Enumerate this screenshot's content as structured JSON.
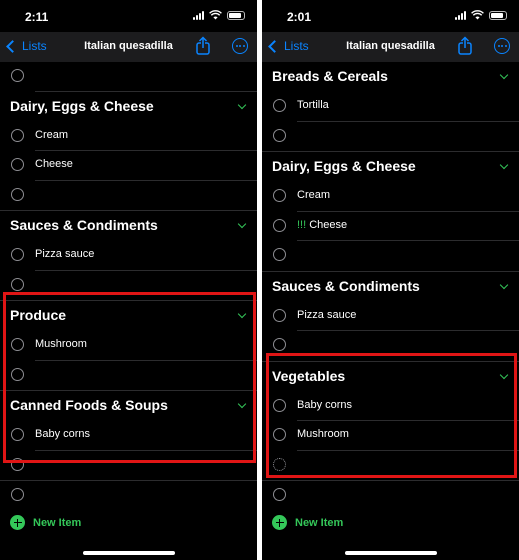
{
  "left": {
    "time": "2:11",
    "back_label": "Lists",
    "title": "Italian quesadilla",
    "sections": [
      {
        "title": "Dairy, Eggs & Cheese",
        "items": [
          "Cream",
          "Cheese"
        ]
      },
      {
        "title": "Sauces & Condiments",
        "items": [
          "Pizza sauce"
        ]
      },
      {
        "title": "Produce",
        "items": [
          "Mushroom"
        ]
      },
      {
        "title": "Canned Foods & Soups",
        "items": [
          "Baby corns"
        ]
      }
    ],
    "new_item_label": "New Item"
  },
  "right": {
    "time": "2:01",
    "back_label": "Lists",
    "title": "Italian quesadilla",
    "sections": [
      {
        "title": "Breads & Cereals",
        "items": [
          "Tortilla"
        ]
      },
      {
        "title": "Dairy, Eggs & Cheese",
        "items": [
          "Cream",
          "Cheese"
        ],
        "priority_prefix": "!!!"
      },
      {
        "title": "Sauces & Condiments",
        "items": [
          "Pizza sauce"
        ]
      },
      {
        "title": "Vegetables",
        "items": [
          "Baby corns",
          "Mushroom"
        ]
      }
    ],
    "new_item_label": "New Item"
  },
  "colors": {
    "accent_blue": "#0a84ff",
    "accent_green": "#34c759",
    "highlight_red": "#e01515",
    "background": "#000000"
  }
}
